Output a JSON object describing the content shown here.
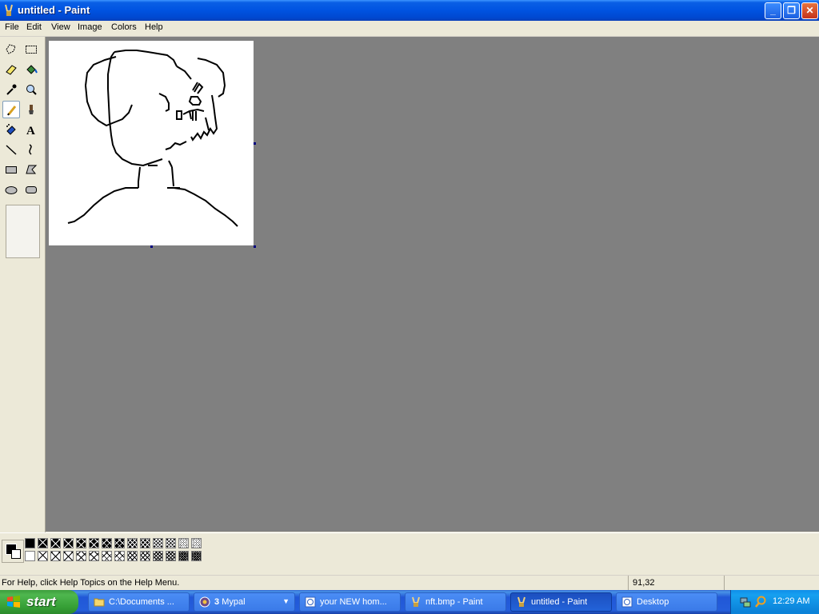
{
  "window": {
    "title": "untitled - Paint"
  },
  "menu": [
    "File",
    "Edit",
    "View",
    "Image",
    "Colors",
    "Help"
  ],
  "toolbox": {
    "tools": [
      "free-form-select",
      "select",
      "eraser",
      "fill-with-color",
      "pick-color",
      "magnifier",
      "pencil",
      "brush",
      "airbrush",
      "text",
      "line",
      "curve",
      "rectangle",
      "polygon",
      "ellipse",
      "rounded-rectangle"
    ],
    "active_tool": "pencil"
  },
  "palette": {
    "foreground": "#000000",
    "background": "#ffffff"
  },
  "status": {
    "help_text": "For Help, click Help Topics on the Help Menu.",
    "coordinates": "91,32"
  },
  "taskbar": {
    "start_label": "start",
    "tasks": [
      {
        "label": "C:\\Documents ...",
        "icon": "folder-icon"
      },
      {
        "count": "3",
        "label": "Mypal",
        "icon": "browser-icon"
      },
      {
        "label": "your NEW hom...",
        "icon": "browser-page-icon"
      },
      {
        "label": "nft.bmp - Paint",
        "icon": "paint-icon"
      },
      {
        "label": "untitled - Paint",
        "icon": "paint-icon",
        "active": true
      },
      {
        "label": "Desktop",
        "icon": "browser-page-icon"
      }
    ],
    "clock": "12:29 AM"
  }
}
